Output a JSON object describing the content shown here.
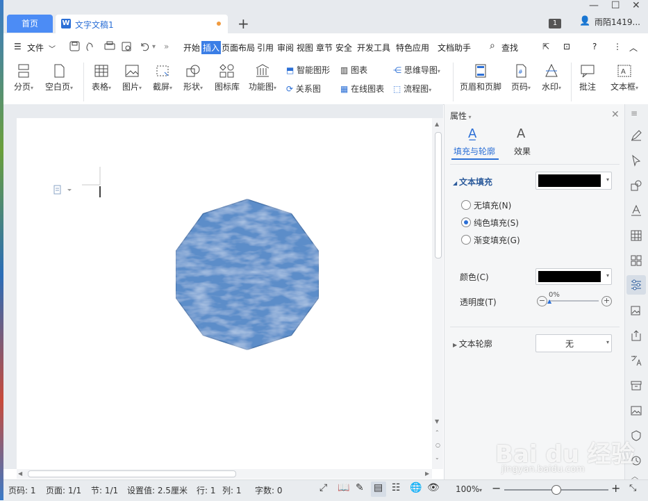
{
  "tabs": {
    "home": "首页",
    "document": "文字文稿1",
    "new_tab": "+"
  },
  "titlebar": {
    "window_count": "1",
    "user": "雨陌1419...",
    "minimize": "—",
    "restore": "☐",
    "close": "✕"
  },
  "menu": {
    "file": "文件",
    "items": [
      "开始",
      "插入",
      "页面布局",
      "引用",
      "审阅",
      "视图",
      "章节",
      "安全",
      "开发工具",
      "特色应用",
      "文档助手"
    ],
    "active": "插入",
    "search": "查找"
  },
  "ribbon": {
    "page_break": "分页",
    "blank_page": "空白页",
    "table": "表格",
    "picture": "图片",
    "screenshot": "截屏",
    "shape": "形状",
    "icon_library": "图标库",
    "function_chart": "功能图",
    "smart_shape": "智能图形",
    "relation_chart": "关系图",
    "chart": "图表",
    "online_chart": "在线图表",
    "mind_map": "思维导图",
    "flowchart": "流程图",
    "header_footer": "页眉和页脚",
    "page_number": "页码",
    "watermark": "水印",
    "comment": "批注",
    "text_box": "文本框"
  },
  "panel": {
    "title": "属性",
    "tab_fill": "填充与轮廓",
    "tab_effect": "效果",
    "text_fill": "文本填充",
    "no_fill": "无填充(N)",
    "solid_fill": "纯色填充(S)",
    "gradient_fill": "渐变填充(G)",
    "color_label": "颜色(C)",
    "transparency_label": "透明度(T)",
    "transparency_value": "0%",
    "text_outline": "文本轮廓",
    "outline_value": "无",
    "fill_color": "#000000"
  },
  "status": {
    "page_no": "页码: 1",
    "pages": "页面: 1/1",
    "section": "节: 1/1",
    "setting": "设置值: 2.5厘米",
    "row": "行: 1",
    "col": "列: 1",
    "words": "字数: 0",
    "zoom": "100%"
  },
  "shape": {
    "fill": "#5b8dc9",
    "stroke": "#4a75ab"
  },
  "watermark": {
    "brand": "Bai du 经验",
    "url": "jingyan.baidu.com"
  }
}
